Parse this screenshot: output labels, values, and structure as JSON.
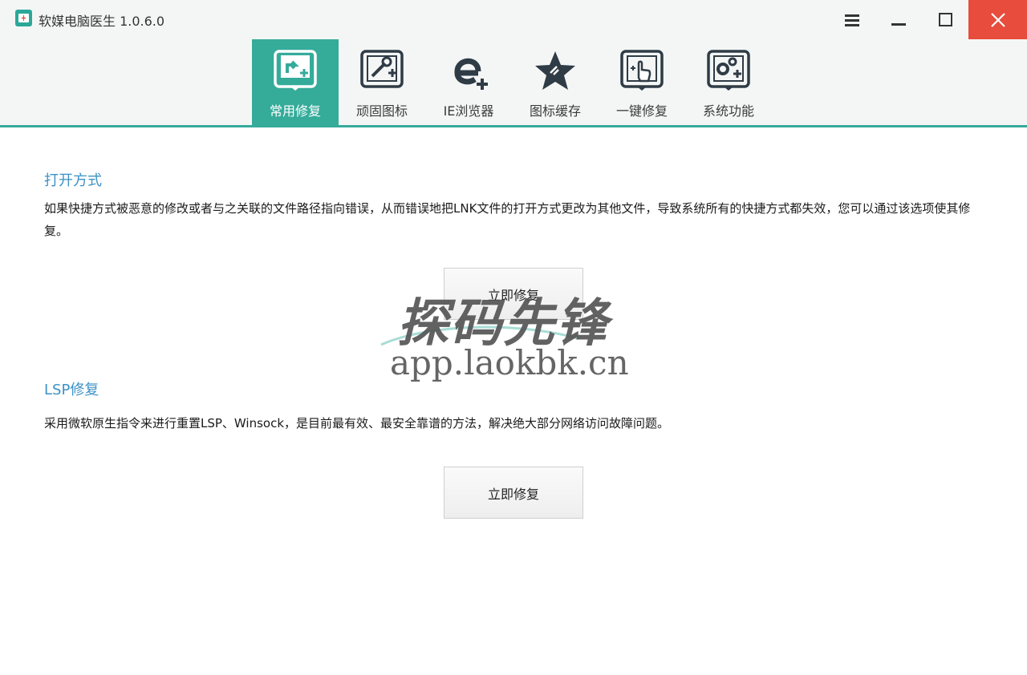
{
  "window": {
    "title": "软媒电脑医生 1.0.6.0"
  },
  "tabs": [
    {
      "label": "常用修复",
      "icon": "shortcut-repair-icon",
      "active": true
    },
    {
      "label": "顽固图标",
      "icon": "wrench-tool-icon",
      "active": false
    },
    {
      "label": "IE浏览器",
      "icon": "ie-browser-icon",
      "active": false
    },
    {
      "label": "图标缓存",
      "icon": "star-icon",
      "active": false
    },
    {
      "label": "一键修复",
      "icon": "hand-pointer-icon",
      "active": false
    },
    {
      "label": "系统功能",
      "icon": "gears-icon",
      "active": false
    }
  ],
  "sections": [
    {
      "title": "打开方式",
      "description": "如果快捷方式被恶意的修改或者与之关联的文件路径指向错误，从而错误地把LNK文件的打开方式更改为其他文件，导致系统所有的快捷方式都失效，您可以通过该选项使其修复。",
      "button_label": "立即修复"
    },
    {
      "title": "LSP修复",
      "description": "采用微软原生指令来进行重置LSP、Winsock，是目前最有效、最安全靠谱的方法，解决绝大部分网络访问故障问题。",
      "button_label": "立即修复"
    }
  ],
  "watermark": {
    "title": "探码先锋",
    "url": "app.laokbk.cn"
  },
  "colors": {
    "accent": "#35ab9a",
    "section_title": "#3c92c7",
    "close_button": "#e74c3c",
    "icon_dark": "#2f3b45"
  }
}
